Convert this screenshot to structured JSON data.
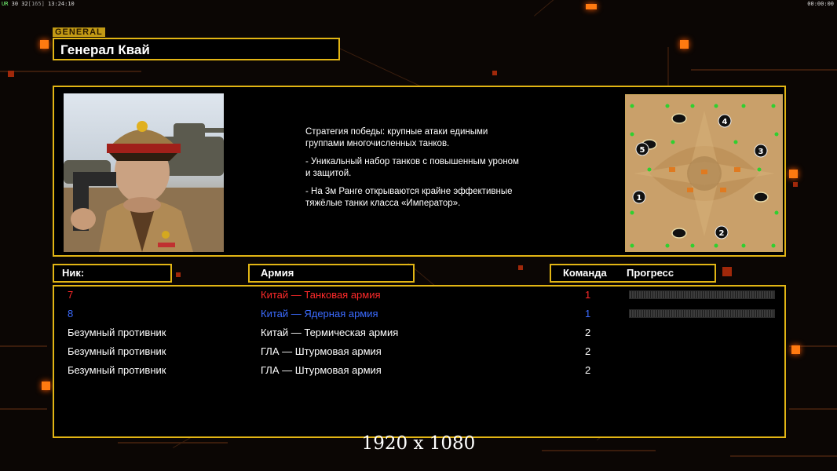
{
  "overlay": {
    "fps_label": "UR",
    "fps_values": "30 32",
    "fps_extra": "[165]",
    "clock": "13:24:10",
    "timer": "00:00:00"
  },
  "general": {
    "tag": "GENERAL",
    "name": "Генерал Квай",
    "description": [
      "Стратегия победы: крупные атаки едиными\n группами многочисленных танков.",
      "- Уникальный набор танков с повышенным уроном\n и защитой.",
      "- На 3м Ранге открываются крайне эффективные\n тяжёлые танки класса «Император»."
    ]
  },
  "minimap": {
    "start_positions": [
      "1",
      "2",
      "3",
      "4",
      "5"
    ]
  },
  "table": {
    "headers": {
      "name": "Ник:",
      "army": "Армия",
      "team": "Команда",
      "progress": "Прогресс"
    },
    "rows": [
      {
        "name": "7",
        "army": "Китай — Танковая армия",
        "team": "1",
        "color": "#ff2a2a",
        "progress": true
      },
      {
        "name": "8",
        "army": "Китай — Ядерная армия",
        "team": "1",
        "color": "#3b6bff",
        "progress": true
      },
      {
        "name": "Безумный противник",
        "army": "Китай — Термическая армия",
        "team": "2",
        "color": "#ffffff",
        "progress": false
      },
      {
        "name": "Безумный противник",
        "army": "ГЛА — Штурмовая армия",
        "team": "2",
        "color": "#ffffff",
        "progress": false
      },
      {
        "name": "Безумный противник",
        "army": "ГЛА — Штурмовая армия",
        "team": "2",
        "color": "#ffffff",
        "progress": false
      }
    ]
  },
  "resolution_text": "1920 x 1080",
  "colors": {
    "accent": "#e2b514",
    "background": "#0b0604",
    "highlight": "#ff7a10"
  }
}
